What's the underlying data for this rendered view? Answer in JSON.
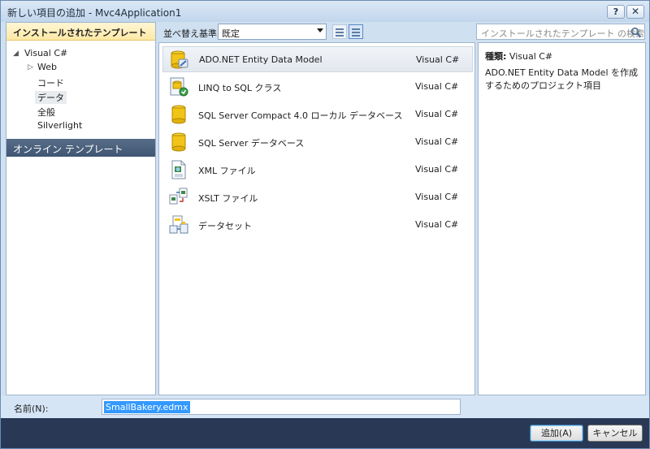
{
  "window": {
    "title": "新しい項目の追加 - Mvc4Application1",
    "help_label": "?",
    "close_label": "✕"
  },
  "sidebar": {
    "header": "インストールされたテンプレート",
    "items": [
      {
        "label": "Visual C#",
        "expanded": true
      },
      {
        "label": "Web",
        "collapsed": true
      },
      {
        "label": "コード"
      },
      {
        "label": "データ",
        "selected": true
      },
      {
        "label": "全般"
      },
      {
        "label": "Silverlight"
      }
    ],
    "online": "オンライン テンプレート"
  },
  "toolbar": {
    "sort_label": "並べ替え基準:",
    "sort_value": "既定",
    "search_placeholder": "インストールされたテンプレート の検索"
  },
  "templates": [
    {
      "name": "ADO.NET Entity Data Model",
      "language": "Visual C#",
      "icon": "entity-model-icon",
      "selected": true
    },
    {
      "name": "LINQ to SQL クラス",
      "language": "Visual C#",
      "icon": "linq-to-sql-icon"
    },
    {
      "name": "SQL Server Compact 4.0 ローカル データベース",
      "language": "Visual C#",
      "icon": "database-icon"
    },
    {
      "name": "SQL Server データベース",
      "language": "Visual C#",
      "icon": "database-icon"
    },
    {
      "name": "XML ファイル",
      "language": "Visual C#",
      "icon": "xml-file-icon"
    },
    {
      "name": "XSLT ファイル",
      "language": "Visual C#",
      "icon": "xslt-file-icon"
    },
    {
      "name": "データセット",
      "language": "Visual C#",
      "icon": "dataset-icon"
    }
  ],
  "details": {
    "type_label": "種類:",
    "type_value": "Visual C#",
    "description": "ADO.NET Entity Data Model を作成するためのプロジェクト項目"
  },
  "name_field": {
    "label": "名前(N):",
    "value": "SmallBakery.edmx"
  },
  "buttons": {
    "add": "追加(A)",
    "cancel": "キャンセル"
  },
  "colors": {
    "footer": "#293955",
    "selection": "#3399ff",
    "online_header": "#3f5572"
  }
}
